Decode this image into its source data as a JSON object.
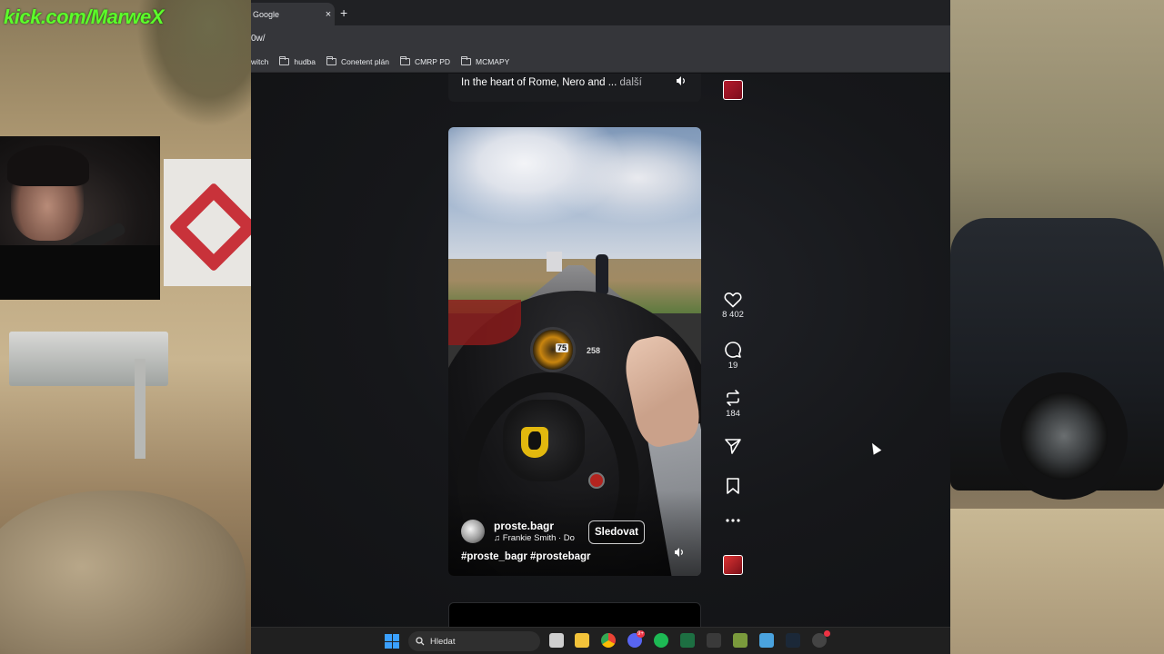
{
  "overlay": {
    "stream_link": "kick.com/MarweX"
  },
  "browser": {
    "tab_title": "Google",
    "tab_close": "×",
    "new_tab": "+",
    "url_fragment": "0w/",
    "bookmarks": [
      {
        "label": "witch",
        "folder": false
      },
      {
        "label": "hudba",
        "folder": true
      },
      {
        "label": "Conetent plán",
        "folder": true
      },
      {
        "label": "CMRP PD",
        "folder": true
      },
      {
        "label": "MCMAPY",
        "folder": true
      }
    ]
  },
  "feed": {
    "prev_caption": "In the heart of Rome, Nero and ...",
    "prev_more": "další",
    "video": {
      "gauge_value": "75",
      "speed_value": "258",
      "author": "proste.bagr",
      "music": "Frankie Smith · Do",
      "follow_label": "Sledovat",
      "hashtags": "#proste_bagr #prostebagr"
    },
    "actions": {
      "likes": "8 402",
      "comments": "19",
      "reposts": "184"
    }
  },
  "taskbar": {
    "search_placeholder": "Hledat",
    "discord_badge": "9+"
  }
}
